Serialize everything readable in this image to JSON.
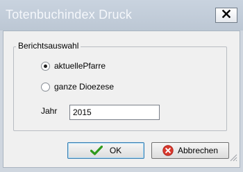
{
  "window": {
    "title": "Totenbuchindex Druck"
  },
  "report_group": {
    "legend": "Berichtsauswahl",
    "options": [
      {
        "label": "aktuellePfarre",
        "selected": true
      },
      {
        "label": "ganze Dioezese",
        "selected": false
      }
    ]
  },
  "year": {
    "label": "Jahr",
    "value": "2015"
  },
  "buttons": {
    "ok_label": "OK",
    "cancel_label": "Abbrechen"
  },
  "icons": {
    "ok": "checkmark-icon",
    "cancel": "cancel-icon",
    "close": "close-icon"
  },
  "colors": {
    "ok_check": "#2e9a1c",
    "cancel_red": "#d8382c",
    "titlebar": "#c2ccd8"
  }
}
